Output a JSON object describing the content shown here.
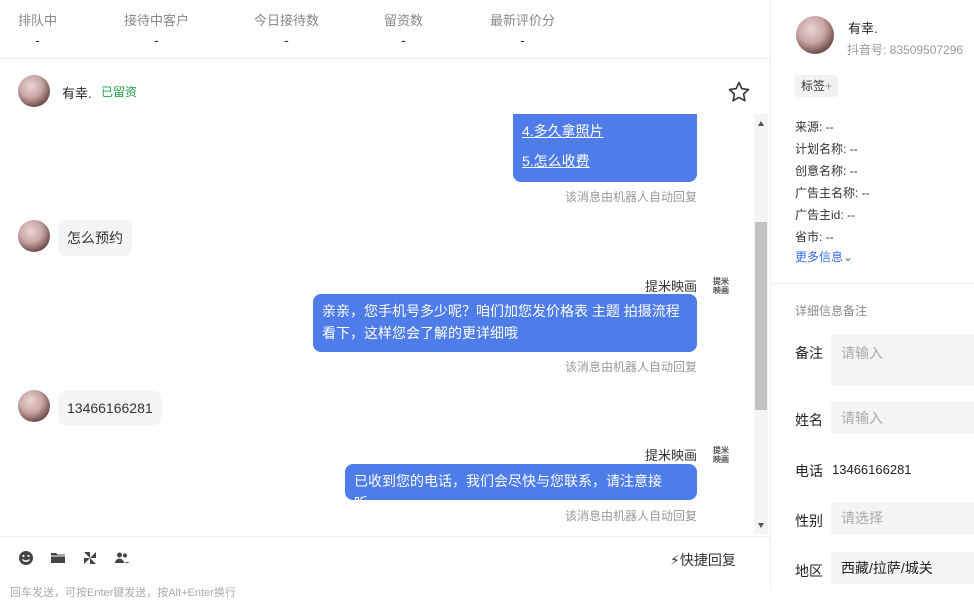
{
  "stats": [
    {
      "label": "排队中",
      "value": "-"
    },
    {
      "label": "接待中客户",
      "value": "-"
    },
    {
      "label": "今日接待数",
      "value": "-"
    },
    {
      "label": "留资数",
      "value": "-"
    },
    {
      "label": "最新评价分",
      "value": "-"
    }
  ],
  "chat": {
    "customer_name": "有幸.",
    "status_badge": "已留资",
    "menu_items": [
      "4.多久拿照片",
      "5.怎么收费"
    ],
    "bot_note": "该消息由机器人自动回复",
    "sender_name": "提米映画",
    "sender_logo_text": "提米映画",
    "messages": [
      {
        "from": "customer",
        "text": "怎么预约"
      },
      {
        "from": "agent",
        "text": "亲亲，您手机号多少呢？咱们加您发价格表 主题 拍摄流程看下，这样您会了解的更详细哦"
      },
      {
        "from": "customer",
        "text": "13466166281"
      },
      {
        "from": "agent",
        "text": "已收到您的电话，我们会尽快与您联系，请注意接听。"
      }
    ]
  },
  "toolbar": {
    "icons": [
      "emoji-icon",
      "folder-icon",
      "pinwheel-icon",
      "users-icon"
    ],
    "quick_reply": "快捷回复",
    "hint": "回车发送，可按Enter键发送，按Alt+Enter换行"
  },
  "side": {
    "name": "有幸.",
    "id_label": "抖音号: 83509507296",
    "tag_button": "标签",
    "info": [
      {
        "label": "来源:",
        "value": "--"
      },
      {
        "label": "计划名称:",
        "value": "--"
      },
      {
        "label": "创意名称:",
        "value": "--"
      },
      {
        "label": "广告主名称:",
        "value": "--"
      },
      {
        "label": "广告主id:",
        "value": "--"
      },
      {
        "label": "省市:",
        "value": "--"
      }
    ],
    "more_info": "更多信息",
    "section_title": "详细信息备注",
    "fields": {
      "note_label": "备注",
      "note_placeholder": "请输入",
      "name_label": "姓名",
      "name_placeholder": "请输入",
      "phone_label": "电话",
      "phone_value": "13466166281",
      "gender_label": "性别",
      "gender_placeholder": "请选择",
      "region_label": "地区",
      "region_value": "西藏/拉萨/城关"
    }
  },
  "colors": {
    "accent": "#4e7ce8",
    "badge": "#22a04b",
    "link": "#3a6ee8"
  }
}
